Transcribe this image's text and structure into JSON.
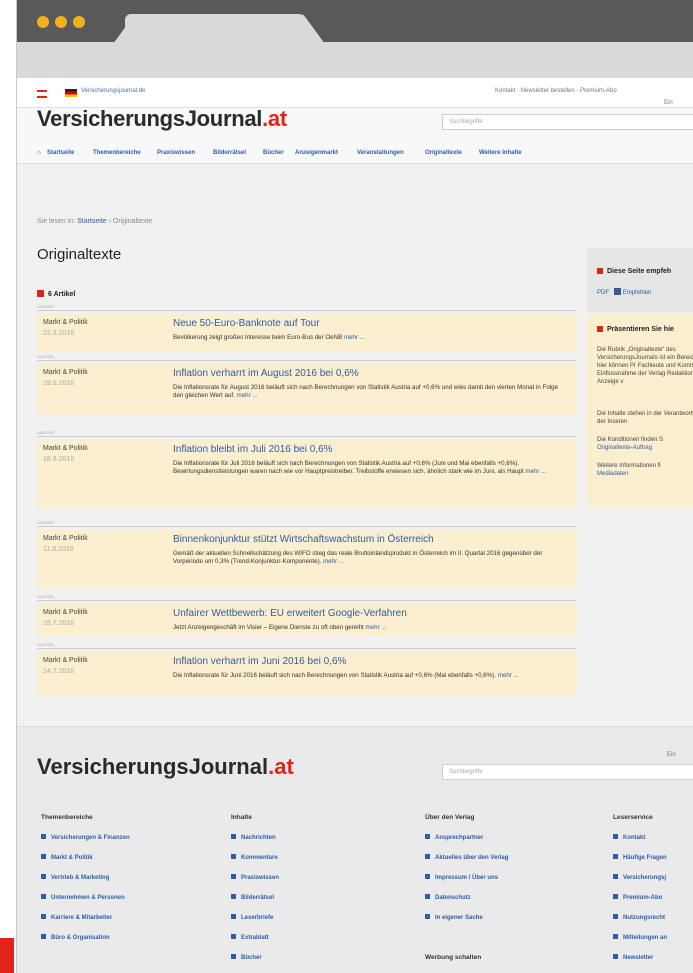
{
  "topbar": {
    "site": "Versicherungsjournal.de",
    "links": "Kontakt · Newsletter bestellen · Premium-Abo"
  },
  "header": {
    "logo_main": "VersicherungsJournal",
    "logo_tld": ".at",
    "search_placeholder": "Suchbegriffe",
    "ein": "Ein"
  },
  "nav": [
    "Startseite",
    "Themenbereiche",
    "Praxiswissen",
    "Bilderrätsel",
    "Bücher",
    "Anzeigenmarkt",
    "Veranstaltungen",
    "Originaltexte",
    "Weitere Inhalte"
  ],
  "breadcrumb": {
    "prefix": "Sie lesen in:",
    "home": "Startseite",
    "current": "› Originaltexte"
  },
  "page_title": "Originaltexte",
  "article_count": "6 Artikel",
  "sep_label": "ANZEIGE",
  "articles": [
    {
      "section": "Markt & Politik",
      "date": "22.9.2016",
      "title": "Neue 50-Euro-Banknote auf Tour",
      "body": "Bevölkerung zeigt großes Interesse beim Euro-Bus der OeNB",
      "more": "mehr ..."
    },
    {
      "section": "Markt & Politik",
      "date": "19.9.2016",
      "title": "Inflation verharrt im August 2016 bei 0,6%",
      "body": "Die Inflationsrate für August 2016 beläuft sich nach Berechnungen von Statistik Austria auf +0,6% und wies damit den vierten Monat in Folge den gleichen Wert auf.",
      "more": "mehr ..."
    },
    {
      "section": "Markt & Politik",
      "date": "18.8.2016",
      "title": "Inflation bleibt im Juli 2016 bei 0,6%",
      "body": "Die Inflationsrate für Juli 2016 beläuft sich nach Berechnungen von Statistik Austria auf +0,6% (Juni und Mai ebenfalls +0,6%). Bewirtungsdienstleistungen waren nach wie vor Hauptpreistreiber. Treibstoffe erwiesen sich, ähnlich stark wie im Juni, als Haupt",
      "more": "mehr ..."
    },
    {
      "section": "Markt & Politik",
      "date": "11.8.2016",
      "title": "Binnenkonjunktur stützt Wirtschaftswachstum in Österreich",
      "body": "Gemäß der aktuellen Schnellschätzung des WIFO stieg das reale Bruttoinlandsprodukt in Österreich im II. Quartal 2016 gegenüber der Vorperiode um 0,3% (Trend-Konjunktur-Komponente).",
      "more": "mehr ..."
    },
    {
      "section": "Markt & Politik",
      "date": "19.7.2016",
      "title": "Unfairer Wettbewerb: EU erweitert Google-Verfahren",
      "body": "Jetzt Anzeigengeschäft im Visier – Eigene Dienste zu oft oben gereiht",
      "more": "mehr ..."
    },
    {
      "section": "Markt & Politik",
      "date": "14.7.2016",
      "title": "Inflation verharrt im Juni 2016 bei 0,6%",
      "body": "Die Inflationsrate für Juni 2016 beläuft sich nach Berechnungen von Statistik Austria auf +0,6% (Mai ebenfalls +0,6%).",
      "more": "mehr ..."
    }
  ],
  "aside": {
    "recommend_title": "Diese Seite empfeh",
    "pdf": "PDF",
    "facebook": "Empfehlen",
    "present_title": "Präsentieren Sie hie",
    "p1": "Die Rubrik „Originaltexte“ des VersicherungsJournals ist ein Bereich, hier können Pr Fachleute und Kommen Einflussnahme der Verlag Redaktion als Anzeige v",
    "p2": "Die Inhalte stehen in der Verantwortung der Inseren",
    "p3": "Die Konditionen finden S",
    "p3_link": "Originaltexte-Auftrag",
    "p4": "Weitere Informationen fi",
    "p4_link": "Mediadaten"
  },
  "footer": {
    "logo_main": "VersicherungsJournal",
    "logo_tld": ".at",
    "search_placeholder": "Suchbegriffe",
    "ein": "Ein",
    "columns": [
      {
        "title": "Themenbereiche",
        "items": [
          "Versicherungen & Finanzen",
          "Markt & Politik",
          "Vertrieb & Marketing",
          "Unternehmen & Personen",
          "Karriere & Mitarbeiter",
          "Büro & Organisation"
        ]
      },
      {
        "title": "Inhalte",
        "items": [
          "Nachrichten",
          "Kommentare",
          "Praxiswissen",
          "Bilderrätsel",
          "Leserbriefe",
          "Extrablatt",
          "Bücher"
        ]
      },
      {
        "title": "Über den Verlag",
        "items": [
          "Ansprechpartner",
          "Aktuelles über den Verlag",
          "Impressum / Über uns",
          "Datenschutz",
          "In eigener Sache"
        ],
        "extra": "Werbung schalten"
      },
      {
        "title": "Leserservice",
        "items": [
          "Kontakt",
          "Häufige Fragen",
          "Versicherungsj",
          "Premium-Abo",
          "Nutzungsrecht",
          "Mitteilungen an",
          "Newsletter"
        ]
      }
    ]
  }
}
